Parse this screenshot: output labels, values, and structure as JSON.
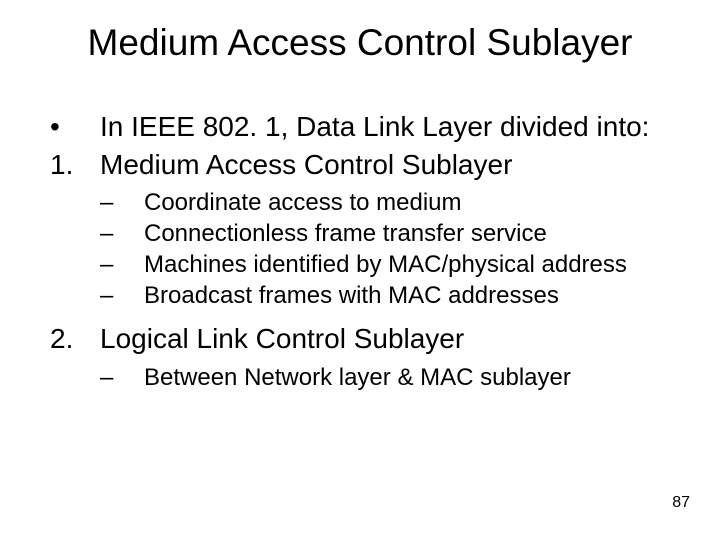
{
  "title": "Medium Access Control Sublayer",
  "intro": {
    "bullet": "•",
    "text": "In IEEE 802. 1, Data Link Layer divided into:"
  },
  "item1": {
    "num": "1.",
    "text": "Medium Access Control Sublayer",
    "subs": [
      {
        "mark": "–",
        "text": "Coordinate access to medium"
      },
      {
        "mark": "–",
        "text": "Connectionless frame transfer service"
      },
      {
        "mark": "–",
        "text": "Machines identified by MAC/physical address"
      },
      {
        "mark": "–",
        "text": "Broadcast frames with MAC addresses"
      }
    ]
  },
  "item2": {
    "num": "2.",
    "text": "Logical Link Control Sublayer",
    "subs": [
      {
        "mark": "–",
        "text": "Between Network layer & MAC sublayer"
      }
    ]
  },
  "page": "87"
}
